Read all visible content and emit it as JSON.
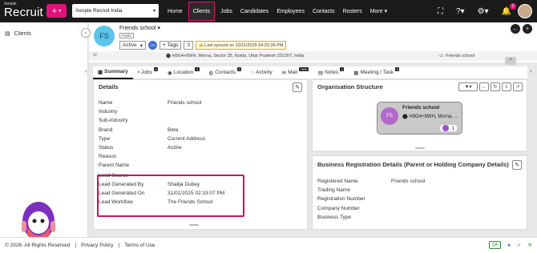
{
  "app": {
    "logo_small": "Xeople",
    "logo_big": "Recruit",
    "org_selector": "Xeople Recruit India"
  },
  "nav": {
    "items": [
      "Home",
      "Clients",
      "Jobs",
      "Candidates",
      "Employees",
      "Contacts",
      "Rosters",
      "More"
    ],
    "active": "Clients",
    "more_arrow": "▾"
  },
  "topbar_icons": {
    "notification_count": "3"
  },
  "sidebar": {
    "clients_label": "Clients"
  },
  "client": {
    "initials": "FS",
    "name": "Friends school",
    "visibility_tag": "Public",
    "status": "Active",
    "tags_label": "Tags",
    "tags_count": "3",
    "sync_text": "Last synced on 13/11/2025 04:20:36 PM",
    "address": "H9G4+8WH, Morna, Sector 35, Noida, Uttar Pradesh 201307, India",
    "website": "Friends school"
  },
  "tabs": [
    {
      "label": "Summary",
      "badge": ""
    },
    {
      "label": "Jobs",
      "badge": "4"
    },
    {
      "label": "Location",
      "badge": "2"
    },
    {
      "label": "Contacts",
      "badge": "2"
    },
    {
      "label": "Activity",
      "badge": ""
    },
    {
      "label": "Mail",
      "badge": "762b"
    },
    {
      "label": "Notes",
      "badge": "1"
    },
    {
      "label": "Meeting / Task",
      "badge": "0"
    }
  ],
  "details": {
    "title": "Details",
    "rows": [
      {
        "label": "Name",
        "value": "Friends school"
      },
      {
        "label": "Industry",
        "value": ""
      },
      {
        "label": "Sub-industry",
        "value": ""
      },
      {
        "label": "Brand",
        "value": "Beta"
      },
      {
        "label": "Type",
        "value": "Current Address"
      },
      {
        "label": "Status",
        "value": "Active"
      },
      {
        "label": "Reason",
        "value": ""
      },
      {
        "label": "Parent Name",
        "value": ""
      },
      {
        "label": "Lead Source",
        "value": ""
      },
      {
        "label": "Lead Generated By",
        "value": "Shailja Dubey"
      },
      {
        "label": "Lead Generated On",
        "value": "31/01/2025 02:33:07 PM"
      },
      {
        "label": "Lead Workflow",
        "value": "The Friends School"
      }
    ]
  },
  "org_structure": {
    "title": "Organisation Structure",
    "node_initials": "FS",
    "node_name": "Friends school",
    "node_location": "H9G4+8WH, Morna, ...",
    "node_count": "1"
  },
  "business": {
    "title": "Business Registration Details (Parent or Holding Company Details)",
    "rows": [
      {
        "label": "Registered Name",
        "value": "Friends school"
      },
      {
        "label": "Trading Name",
        "value": ""
      },
      {
        "label": "Registration Number",
        "value": ""
      },
      {
        "label": "Company Number",
        "value": ""
      },
      {
        "label": "Business Type",
        "value": ""
      }
    ]
  },
  "footer": {
    "copyright": "© 2026. All Rights Reserved",
    "privacy": "Privacy Policy",
    "terms": "Terms of Use",
    "qa_badge": "QA"
  },
  "colors": {
    "accent": "#e0127c",
    "highlight_border": "#c2185b",
    "topbar": "#1a1a1a",
    "avatar_client": "#5cc4e8"
  }
}
